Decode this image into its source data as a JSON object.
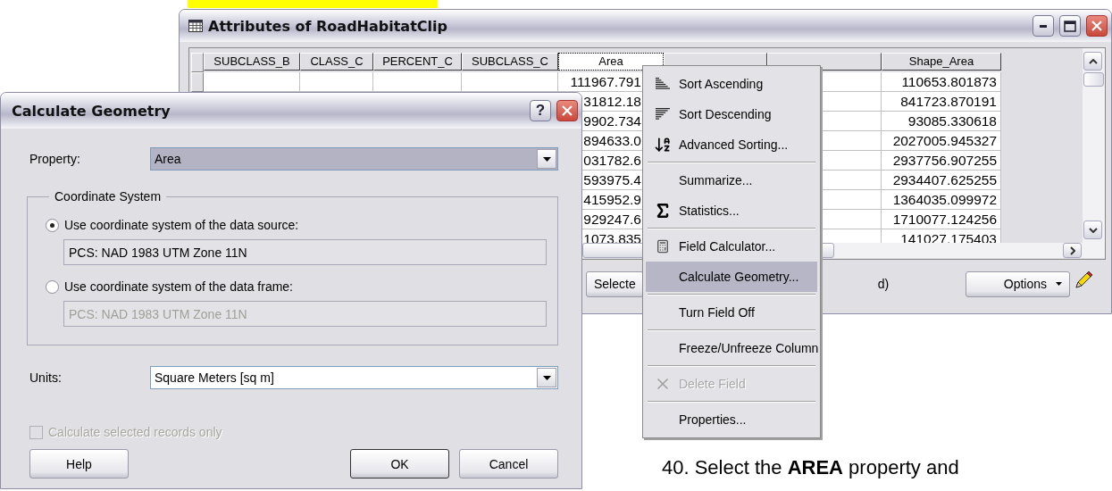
{
  "attributes_window": {
    "title": "Attributes of RoadHabitatClip",
    "columns": [
      {
        "label": "SUBCLASS_B",
        "selected": false
      },
      {
        "label": "CLASS_C",
        "selected": false
      },
      {
        "label": "PERCENT_C",
        "selected": false
      },
      {
        "label": "SUBCLASS_C",
        "selected": false
      },
      {
        "label": "Area",
        "selected": true
      },
      {
        "selected": false
      },
      {
        "selected": false
      },
      {
        "label": "Shape_Area",
        "selected": false
      }
    ],
    "rows": [
      {
        "area": "111967.791",
        "shape_area": "110653.801873"
      },
      {
        "area": "31812.18",
        "shape_area": "841723.870191"
      },
      {
        "area": "9902.734",
        "shape_area": "93085.330618"
      },
      {
        "area": "894633.0",
        "shape_area": "2027005.945327"
      },
      {
        "area": "031782.6",
        "shape_area": "2937756.907255"
      },
      {
        "area": "593975.4",
        "shape_area": "2934407.625255"
      },
      {
        "area": "415952.9",
        "shape_area": "1364035.099972"
      },
      {
        "area": "929247.6",
        "shape_area": "1710077.124256"
      },
      {
        "area": "1073.835",
        "shape_area": "141027.175403"
      }
    ],
    "status_bar": {
      "selected_button": "Selecte",
      "text": "d)",
      "options_button": "Options"
    }
  },
  "dialog": {
    "title": "Calculate Geometry",
    "help_glyph": "?",
    "property": {
      "label": "Property:",
      "value": "Area",
      "focused": true
    },
    "coordinate_system": {
      "legend": "Coordinate System",
      "options": [
        {
          "label": "Use coordinate system of the data source:",
          "selected": true,
          "value": "PCS: NAD 1983 UTM Zone 11N",
          "disabled": false
        },
        {
          "label": "Use coordinate system of the data frame:",
          "selected": false,
          "value": "PCS: NAD 1983 UTM Zone 11N",
          "disabled": true
        }
      ]
    },
    "units": {
      "label": "Units:",
      "value": "Square Meters [sq m]",
      "focused": false
    },
    "checkbox": {
      "label": "Calculate selected records only",
      "checked": false,
      "disabled": true
    },
    "buttons": [
      {
        "label": "Help",
        "default": false
      },
      {
        "label": "OK",
        "default": true
      },
      {
        "label": "Cancel",
        "default": false
      }
    ]
  },
  "context_menu": [
    {
      "kind": "item",
      "label": "Sort Ascending",
      "selected": false,
      "disabled": false
    },
    {
      "kind": "item",
      "label": "Sort Descending",
      "selected": false,
      "disabled": false
    },
    {
      "kind": "item",
      "label": "Advanced Sorting...",
      "selected": false,
      "disabled": false
    },
    {
      "kind": "separator"
    },
    {
      "kind": "item",
      "label": "Summarize...",
      "selected": false,
      "disabled": false
    },
    {
      "kind": "item",
      "label": "Statistics...",
      "selected": false,
      "disabled": false
    },
    {
      "kind": "separator"
    },
    {
      "kind": "item",
      "label": "Field Calculator...",
      "selected": false,
      "disabled": false
    },
    {
      "kind": "item",
      "label": "Calculate Geometry...",
      "selected": true,
      "disabled": false
    },
    {
      "kind": "separator"
    },
    {
      "kind": "item",
      "label": "Turn Field Off",
      "selected": false,
      "disabled": false
    },
    {
      "kind": "separator"
    },
    {
      "kind": "item",
      "label": "Freeze/Unfreeze Column",
      "selected": false,
      "disabled": false
    },
    {
      "kind": "separator"
    },
    {
      "kind": "item",
      "label": "Delete Field",
      "selected": false,
      "disabled": true
    },
    {
      "kind": "separator"
    },
    {
      "kind": "item",
      "label": "Properties...",
      "selected": false,
      "disabled": false
    }
  ],
  "caption": "40. Select the **AREA** property and"
}
